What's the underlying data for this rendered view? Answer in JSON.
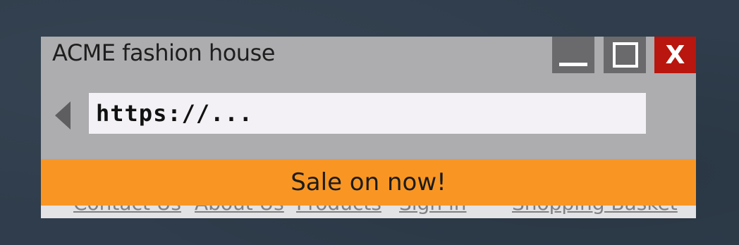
{
  "window": {
    "title": "ACME fashion house",
    "controls": {
      "minimize_icon": "minimize-icon",
      "maximize_icon": "maximize-icon",
      "close_label": "X",
      "close_color": "#b8160e"
    }
  },
  "toolbar": {
    "back_icon": "back-arrow-icon",
    "address_value": "https://..."
  },
  "banner": {
    "text": "Sale on now!",
    "color": "#f99623"
  },
  "nav": {
    "links": [
      "Contact Us",
      "About Us",
      "Products",
      "Sign in",
      "Shopping Basket"
    ]
  }
}
